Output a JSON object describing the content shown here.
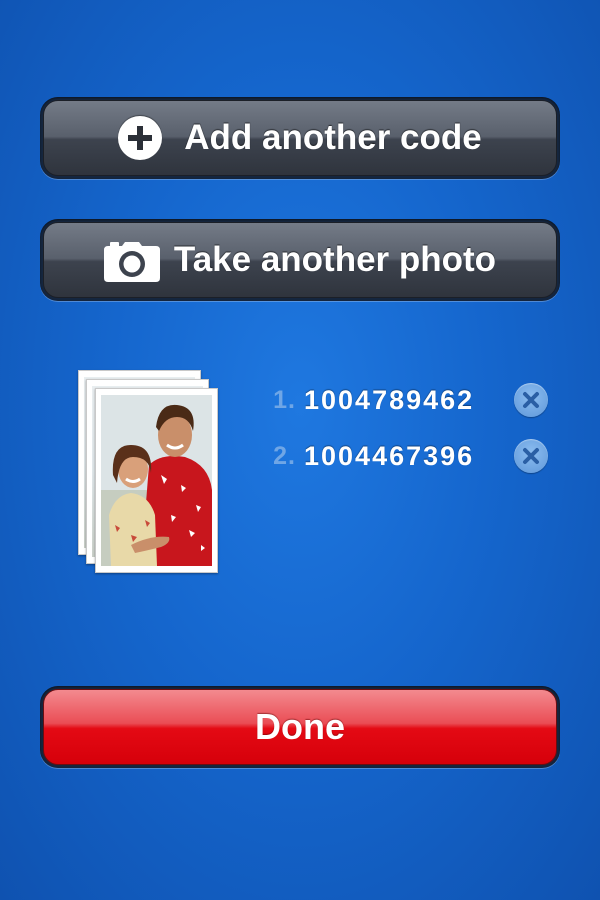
{
  "actions": {
    "add_code_label": "Add another code",
    "add_code_icon": "plus-circle-icon",
    "take_photo_label": "Take another photo",
    "take_photo_icon": "camera-icon",
    "done_label": "Done"
  },
  "photos": {
    "stack_count": 3
  },
  "codes": [
    {
      "index": "1.",
      "value": "1004789462",
      "remove_icon": "close-circle-icon"
    },
    {
      "index": "2.",
      "value": "1004467396",
      "remove_icon": "close-circle-icon"
    }
  ],
  "colors": {
    "background": "#1566cd",
    "dark_button": "#3d434e",
    "done_button": "#e40a14",
    "code_index": "#6fa6e6",
    "remove_button": "#5e97d9"
  }
}
